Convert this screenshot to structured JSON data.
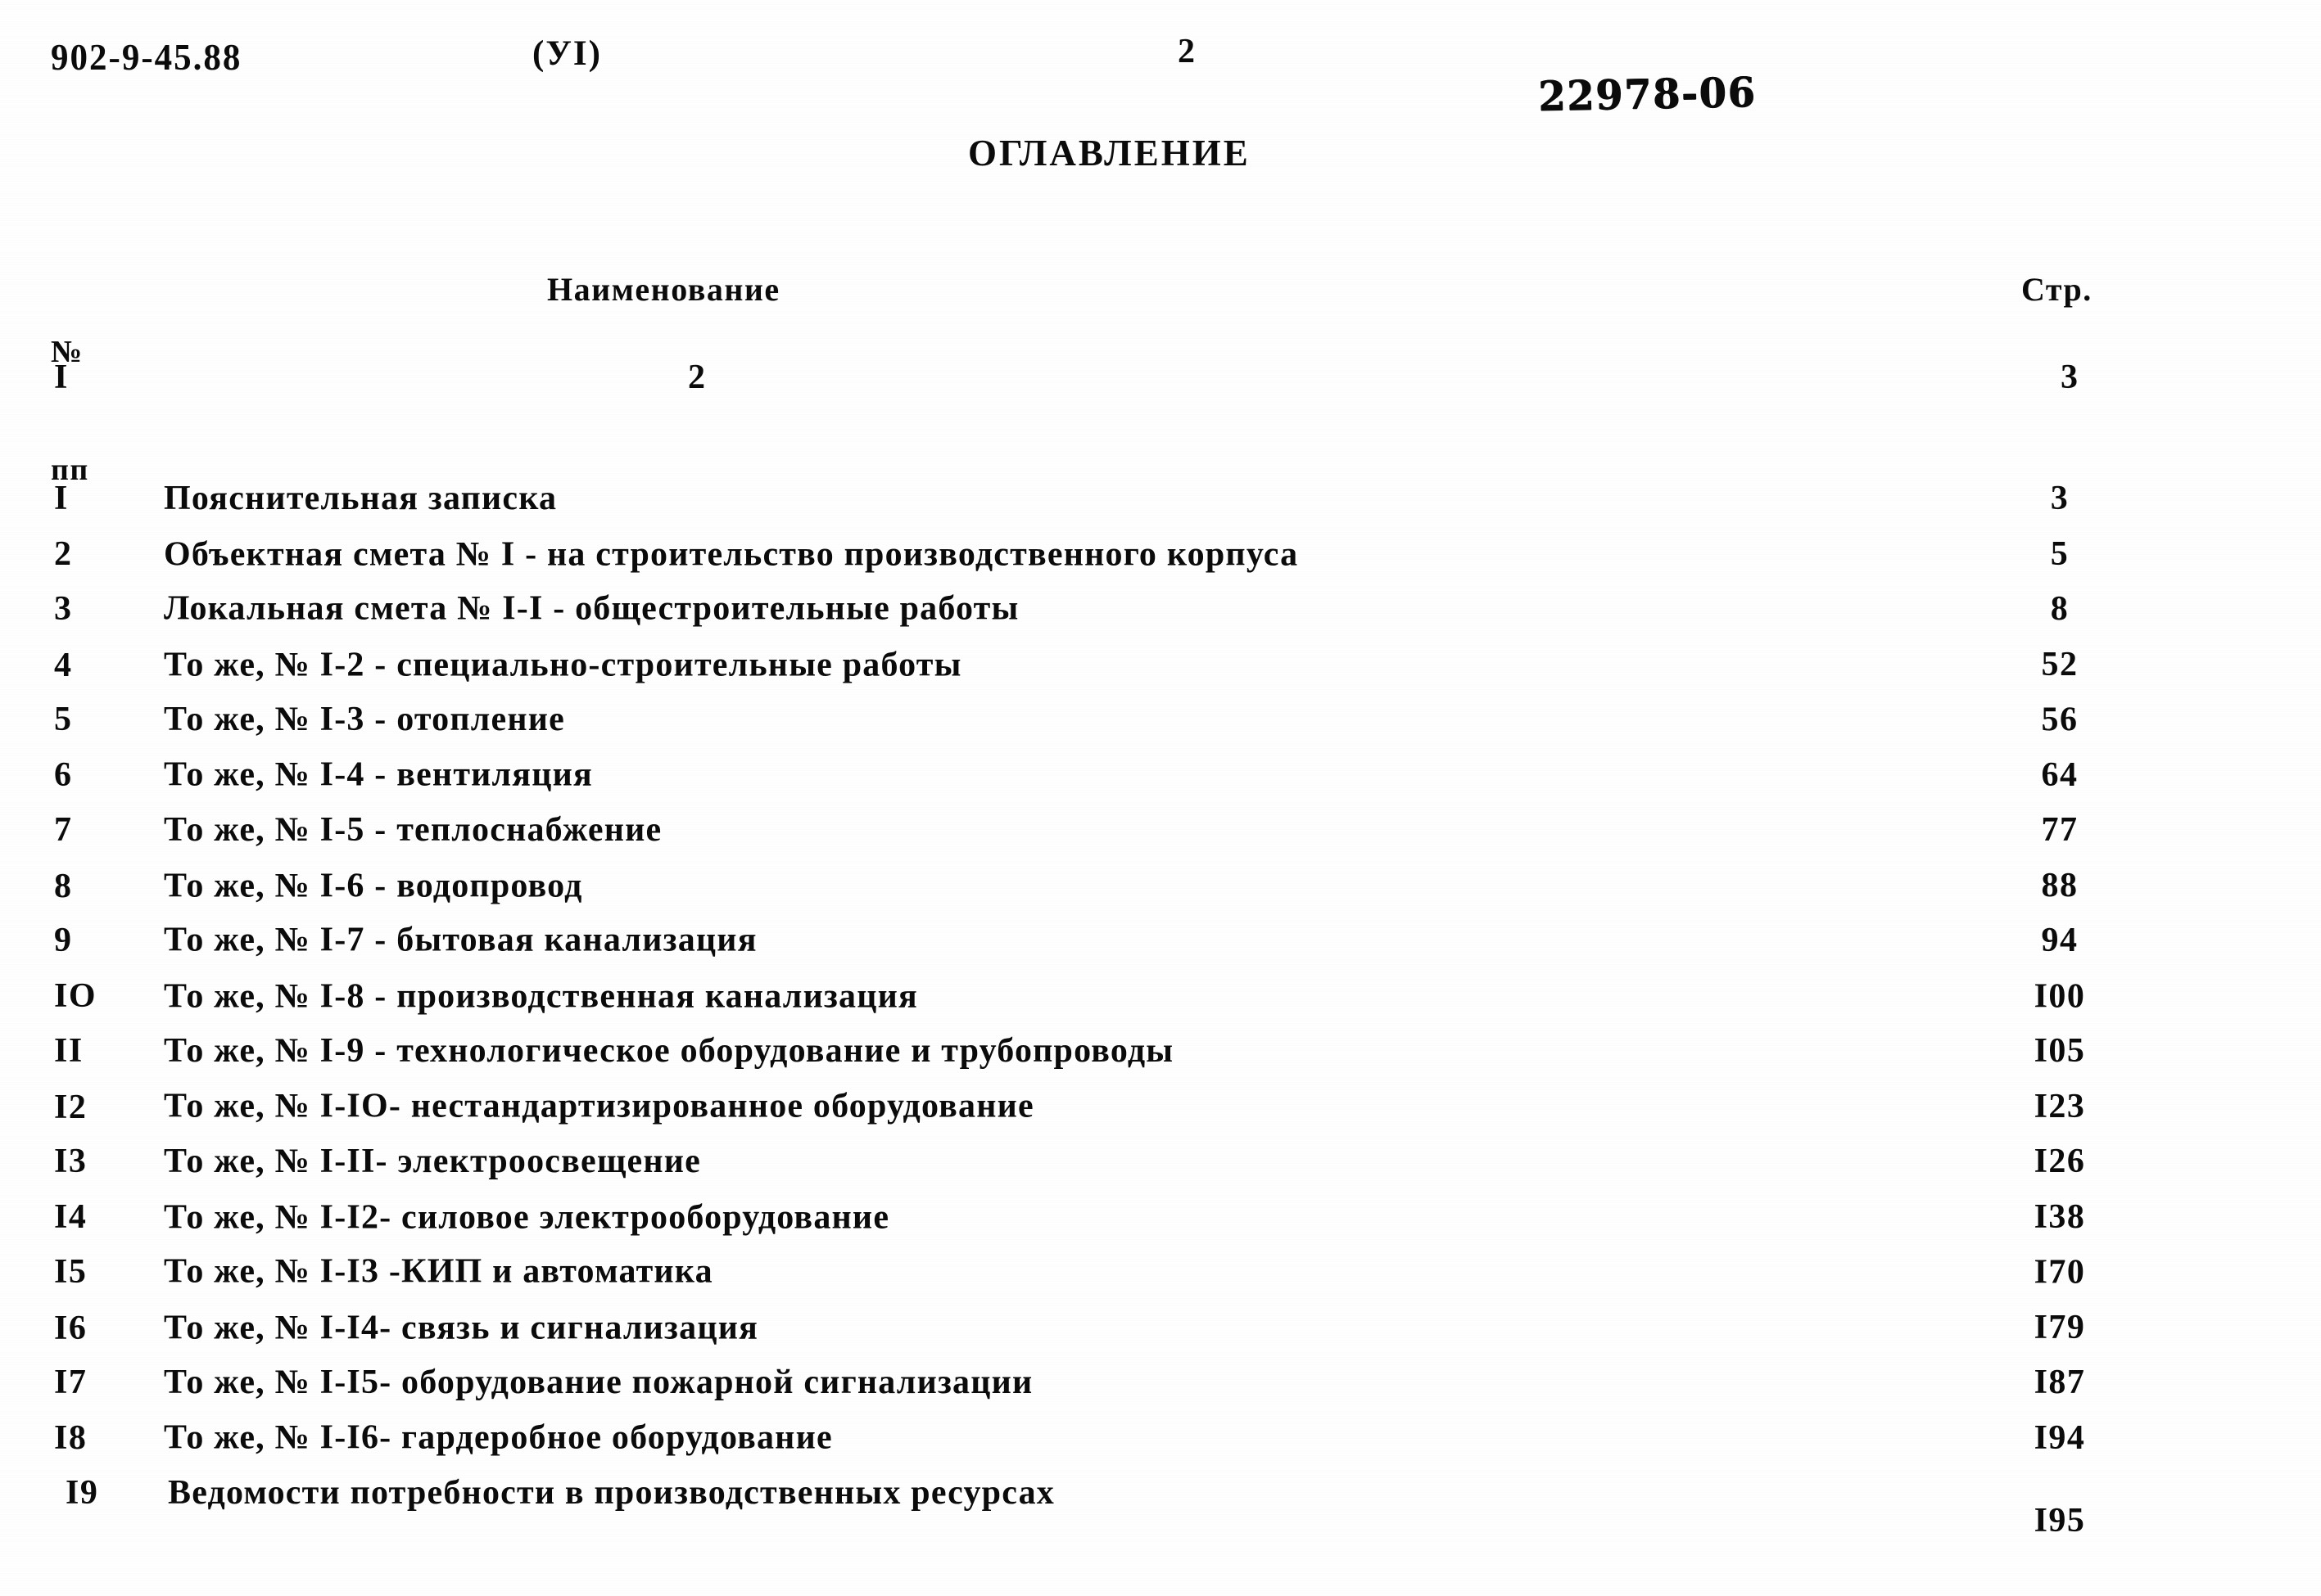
{
  "header": {
    "doc_code": "902-9-45.88",
    "album_mark": "(УI)",
    "page_number": "2",
    "stamp": "22978-06",
    "title": "ОГЛАВЛЕНИЕ"
  },
  "table": {
    "columns": {
      "num_line1": "№",
      "num_line2": "пп",
      "name": "Наименование",
      "page": "Стр."
    },
    "column_index": {
      "col1": "I",
      "col2": "2",
      "col3": "3"
    },
    "rows": [
      {
        "no": "I",
        "name": "Пояснительная записка",
        "page": "3"
      },
      {
        "no": "2",
        "name": "Объектная смета № I - на строительство производственного корпуса",
        "page": "5"
      },
      {
        "no": "3",
        "name": "Локальная смета № I-I - общестроительные работы",
        "page": "8"
      },
      {
        "no": "4",
        "name": "То же, № I-2 - специально-строительные работы",
        "page": "52"
      },
      {
        "no": "5",
        "name": "То же, № I-3 - отопление",
        "page": "56"
      },
      {
        "no": "6",
        "name": "То же, № I-4 - вентиляция",
        "page": "64"
      },
      {
        "no": "7",
        "name": "То же, № I-5 - теплоснабжение",
        "page": "77"
      },
      {
        "no": "8",
        "name": "То же, № I-6 - водопровод",
        "page": "88"
      },
      {
        "no": "9",
        "name": "То же, № I-7 - бытовая канализация",
        "page": "94"
      },
      {
        "no": "IO",
        "name": "То же, № I-8 - производственная канализация",
        "page": "I00"
      },
      {
        "no": "II",
        "name": "То же, № I-9 - технологическое оборудование и трубопроводы",
        "page": "I05"
      },
      {
        "no": "I2",
        "name": "То же, № I-IO- нестандартизированное оборудование",
        "page": "I23"
      },
      {
        "no": "I3",
        "name": "То же, № I-II- электроосвещение",
        "page": "I26"
      },
      {
        "no": "I4",
        "name": "То же, № I-I2- силовое электрооборудование",
        "page": "I38"
      },
      {
        "no": "I5",
        "name": "То же, № I-I3 -КИП и автоматика",
        "page": "I70"
      },
      {
        "no": "I6",
        "name": "То же, № I-I4- связь и сигнализация",
        "page": "I79"
      },
      {
        "no": "I7",
        "name": "То же, № I-I5- оборудование пожарной сигнализации",
        "page": "I87"
      },
      {
        "no": "I8",
        "name": "То же, № I-I6- гардеробное оборудование",
        "page": "I94"
      },
      {
        "no": "I9",
        "name": "Ведомости потребности в производственных ресурсах",
        "page": "I95"
      }
    ]
  }
}
